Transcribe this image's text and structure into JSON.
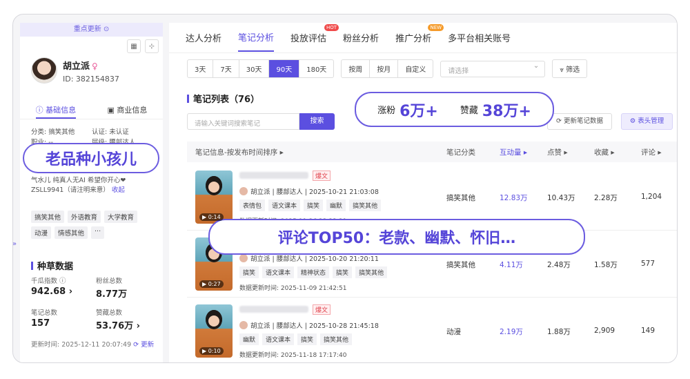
{
  "left": {
    "top_update": "重点更新 ⊙",
    "name": "胡立派",
    "gender_symbol": "♀",
    "id_text": "ID: 382154837",
    "tab_basic": "基础信息",
    "tab_business": "商业信息",
    "category": "分类: 搞笑其他",
    "auth": "认证: 未认证",
    "job": "职业: --",
    "position": "层级: 腰部达人",
    "bio": "气水儿 纯真人无AI 希望你开心❤",
    "contact": "ZSLL9941（请注明来意）",
    "collapse": "收起",
    "tags": [
      "搞笑其他",
      "外语教育",
      "大学教育",
      "动漫",
      "情感其他",
      "···"
    ],
    "section_title": "种草数据",
    "stats": [
      {
        "label": "千瓜指数 ⓘ",
        "value": "942.68 ›"
      },
      {
        "label": "粉丝总数",
        "value": "8.77万"
      },
      {
        "label": "笔记总数",
        "value": "157"
      },
      {
        "label": "赞藏总数",
        "value": "53.76万 ›"
      }
    ],
    "update_time": "更新时间: 2025-12-11 20:07:49",
    "refresh": "⟳ 更新"
  },
  "nav": {
    "items": [
      "达人分析",
      "笔记分析",
      "投放评估",
      "粉丝分析",
      "推广分析",
      "多平台相关账号"
    ],
    "hot": "HOT",
    "new": "NEW"
  },
  "filters": {
    "days": [
      "3天",
      "7天",
      "30天",
      "90天",
      "180天"
    ],
    "period": [
      "按周",
      "按月",
      "自定义"
    ],
    "select_placeholder": "请选择",
    "filter_btn": "⩔ 筛选"
  },
  "list": {
    "title": "笔记列表（76）",
    "search_placeholder": "请输入关键词搜索笔记",
    "search_btn": "搜索",
    "refresh_btn": "⟳ 更新笔记数据",
    "header_mgr": "⚙ 表头管理",
    "columns": [
      "笔记信息-按发布时间排序 ▸",
      "笔记分类",
      "互动量 ▸",
      "点赞 ▸",
      "收藏 ▸",
      "评论 ▸"
    ],
    "rows": [
      {
        "duration": "▶ 0:14",
        "badge": "爆文",
        "author": "胡立派 | 腰部达人 | 2025-10-21 21:03:08",
        "tags": [
          "表情包",
          "语文课本",
          "搞笑",
          "幽默",
          "搞笑其他"
        ],
        "update": "数据更新时间: 2025-11-26 23:22:31",
        "category": "搞笑其他",
        "interact": "12.83万",
        "likes": "10.43万",
        "saves": "2.28万",
        "comments": "1,204"
      },
      {
        "duration": "▶ 0:27",
        "badge": "爆文",
        "author": "胡立派 | 腰部达人 | 2025-10-20 21:20:11",
        "tags": [
          "搞笑",
          "语文课本",
          "精神状态",
          "搞笑",
          "搞笑其他"
        ],
        "update": "数据更新时间: 2025-11-09 21:42:51",
        "category": "搞笑其他",
        "interact": "4.11万",
        "likes": "2.48万",
        "saves": "1.58万",
        "comments": "577"
      },
      {
        "duration": "▶ 0:10",
        "badge": "爆文",
        "author": "胡立派 | 腰部达人 | 2025-10-28 21:45:18",
        "tags": [
          "幽默",
          "语文课本",
          "搞笑",
          "搞笑其他"
        ],
        "update": "数据更新时间: 2025-11-18 17:17:40",
        "category": "动漫",
        "interact": "2.19万",
        "likes": "1.88万",
        "saves": "2,909",
        "comments": "149"
      }
    ]
  },
  "callouts": {
    "fans_label": "涨粉",
    "fans_value": "6万+",
    "likes_label": "赞藏",
    "likes_value": "38万+",
    "old_kid": "老品种小孩儿",
    "comments": "评论TOP50：老款、幽默、怀旧…"
  },
  "colors": {
    "accent": "#5b4fe0",
    "hot": "#f04a4a",
    "new": "#f59b2b"
  }
}
